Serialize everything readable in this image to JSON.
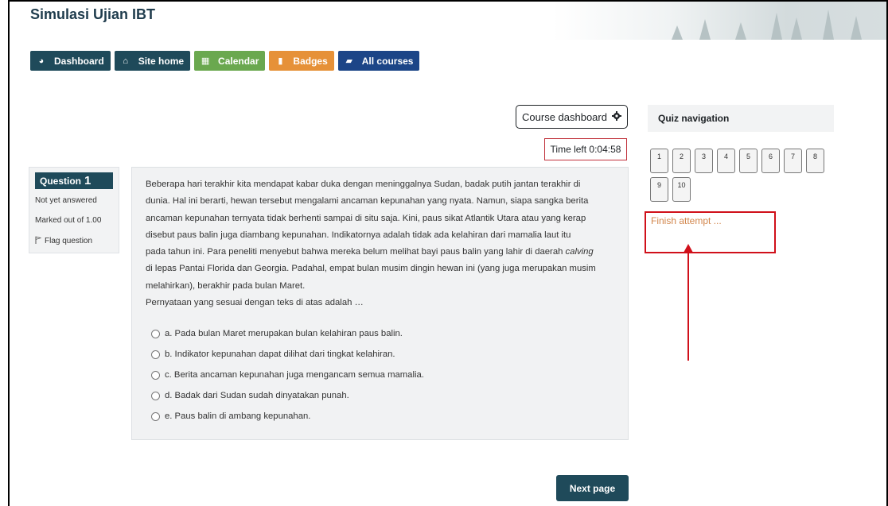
{
  "site": {
    "title": "Simulasi Ujian IBT"
  },
  "navbar": [
    {
      "label": "Dashboard",
      "icon": "dashboard-icon",
      "color": "#1f4a5a",
      "glyph": "◕"
    },
    {
      "label": "Site home",
      "icon": "home-icon",
      "color": "#1f4a5a",
      "glyph": "⌂"
    },
    {
      "label": "Calendar",
      "icon": "calendar-icon",
      "color": "#6aa84f",
      "glyph": "▦"
    },
    {
      "label": "Badges",
      "icon": "bookmark-icon",
      "color": "#e69138",
      "glyph": "▮"
    },
    {
      "label": "All courses",
      "icon": "book-icon",
      "color": "#1c4587",
      "glyph": "▰"
    }
  ],
  "course_dashboard": {
    "label": "Course dashboard",
    "icon": "gear-icon"
  },
  "timer": {
    "text": "Time left 0:04:58"
  },
  "question_info": {
    "label": "Question",
    "number": "1",
    "state": "Not yet answered",
    "marks": "Marked out of 1.00",
    "flag": "Flag question"
  },
  "question": {
    "text": [
      "Beberapa hari terakhir kita mendapat kabar duka dengan meninggalnya Sudan, badak putih jantan terakhir di",
      "dunia. Hal ini berarti, hewan tersebut mengalami ancaman kepunahan yang nyata. Namun, siapa sangka berita",
      "ancaman kepunahan ternyata tidak berhenti sampai di situ saja. Kini, paus sikat Atlantik Utara atau yang kerap",
      "disebut paus balin juga diambang kepunahan. Indikatornya adalah tidak ada kelahiran dari mamalia laut itu",
      "pada tahun ini. Para peneliti menyebut bahwa mereka belum melihat bayi paus balin yang lahir di daerah",
      "di lepas Pantai Florida dan Georgia. Padahal, empat bulan musim dingin hewan ini (yang juga merupakan musim",
      "melahirkan), berakhir pada bulan Maret."
    ],
    "italic_word": "calving",
    "prompt": "Pernyataan yang sesuai dengan teks di atas adalah …",
    "answers": [
      "a. Pada bulan Maret merupakan bulan kelahiran paus balin.",
      "b. Indikator kepunahan dapat dilihat dari tingkat kelahiran.",
      "c. Berita ancaman kepunahan juga mengancam semua mamalia.",
      "d. Badak dari Sudan sudah dinyatakan punah.",
      "e. Paus balin di ambang kepunahan."
    ]
  },
  "quiz_nav": {
    "title": "Quiz navigation",
    "items": [
      "1",
      "2",
      "3",
      "4",
      "5",
      "6",
      "7",
      "8",
      "9",
      "10"
    ],
    "finish": "Finish attempt ..."
  },
  "next_button": {
    "label": "Next page"
  },
  "colors": {
    "primary": "#1f4a5a",
    "annotation": "#d0101a",
    "finish_link": "#d2864c"
  }
}
